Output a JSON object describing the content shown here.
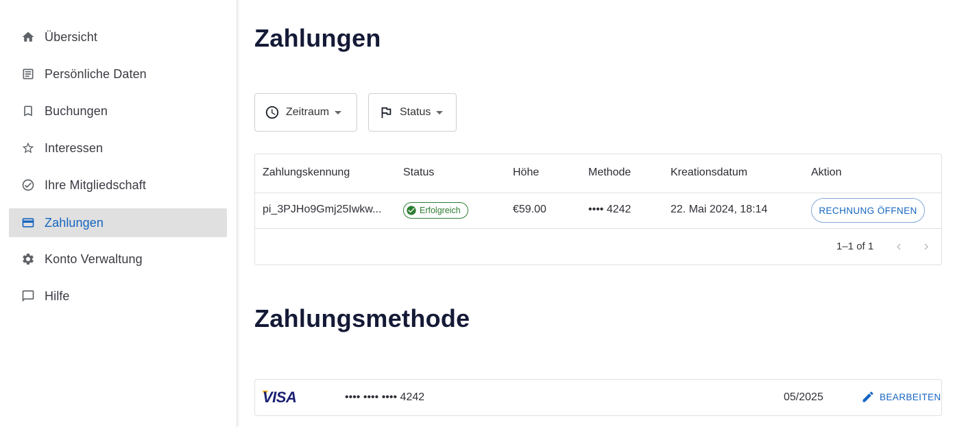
{
  "sidebar": {
    "items": [
      {
        "label": "Übersicht",
        "icon": "home-icon"
      },
      {
        "label": "Persönliche Daten",
        "icon": "document-icon"
      },
      {
        "label": "Buchungen",
        "icon": "bookmark-icon"
      },
      {
        "label": "Interessen",
        "icon": "star-icon"
      },
      {
        "label": "Ihre Mitgliedschaft",
        "icon": "check-circle-icon"
      },
      {
        "label": "Zahlungen",
        "icon": "credit-card-icon",
        "active": true
      },
      {
        "label": "Konto Verwaltung",
        "icon": "gear-icon"
      },
      {
        "label": "Hilfe",
        "icon": "chat-icon"
      }
    ]
  },
  "payments": {
    "title": "Zahlungen",
    "filters": {
      "period": {
        "label": "Zeitraum",
        "icon": "clock-icon"
      },
      "status": {
        "label": "Status",
        "icon": "flag-icon"
      }
    },
    "table": {
      "columns": [
        "Zahlungskennung",
        "Status",
        "Höhe",
        "Methode",
        "Kreationsdatum",
        "Aktion"
      ],
      "rows": [
        {
          "id": "pi_3PJHo9Gmj25Iwkw...",
          "status": "Erfolgreich",
          "amount": "€59.00",
          "method": "•••• 4242",
          "created": "22. Mai 2024, 18:14",
          "action": "RECHNUNG ÖFFNEN"
        }
      ],
      "pagination": "1–1 of 1"
    }
  },
  "payment_method": {
    "title": "Zahlungsmethode",
    "brand": "VISA",
    "number": "•••• •••• •••• 4242",
    "expiry": "05/2025",
    "edit_label": "BEARBEITEN"
  },
  "colors": {
    "accent": "#1565c0",
    "success": "#2e7d32",
    "heading": "#141a36",
    "active_bg": "#e0e0e0"
  }
}
